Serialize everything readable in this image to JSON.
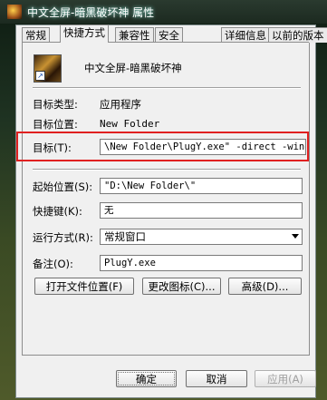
{
  "window": {
    "title": "中文全屏-暗黑破坏神 属性"
  },
  "tabs": [
    {
      "label": "常规"
    },
    {
      "label": "快捷方式"
    },
    {
      "label": "兼容性"
    },
    {
      "label": "安全"
    },
    {
      "label": "详细信息"
    },
    {
      "label": "以前的版本"
    }
  ],
  "shortcut": {
    "name": "中文全屏-暗黑破坏神",
    "target_type_label": "目标类型:",
    "target_type_value": "应用程序",
    "target_location_label": "目标位置:",
    "target_location_value": "New Folder",
    "target_label": "目标(T):",
    "target_value": "\\New Folder\\PlugY.exe\" -direct -windows",
    "start_in_label": "起始位置(S):",
    "start_in_value": "\"D:\\New Folder\\\"",
    "hotkey_label": "快捷键(K):",
    "hotkey_value": "无",
    "run_label": "运行方式(R):",
    "run_value": "常规窗口",
    "comment_label": "备注(O):",
    "comment_value": "PlugY.exe"
  },
  "buttons": {
    "open_location": "打开文件位置(F)",
    "change_icon": "更改图标(C)...",
    "advanced": "高级(D)...",
    "ok": "确定",
    "cancel": "取消",
    "apply": "应用(A)"
  },
  "icons": {
    "title": "game-app-icon",
    "shortcut": "game-shortcut-icon",
    "dropdown": "chevron-down-icon"
  }
}
